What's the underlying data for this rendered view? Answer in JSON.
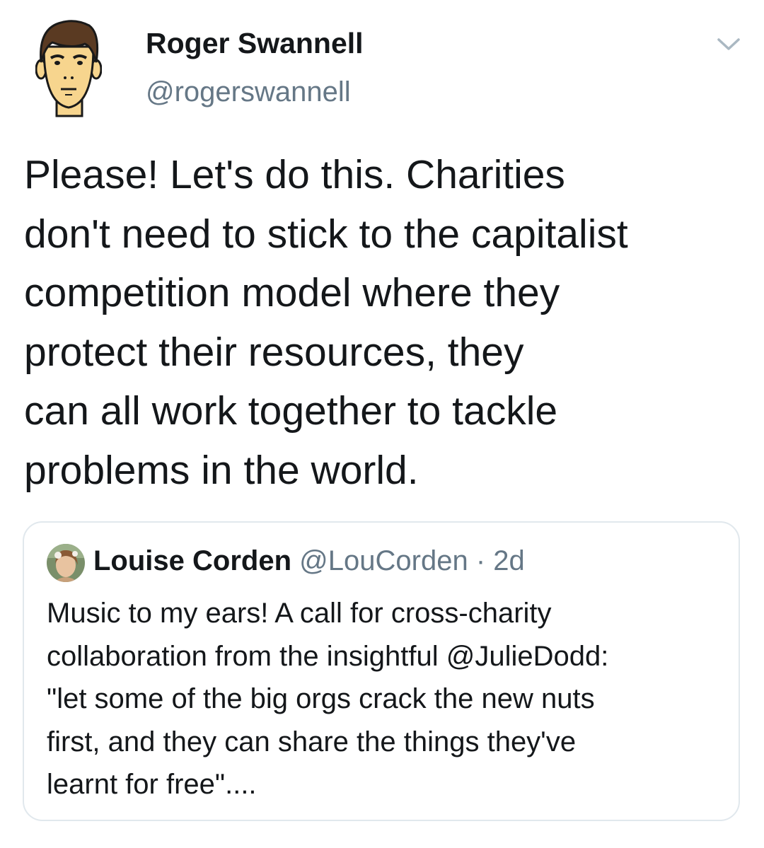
{
  "tweet": {
    "author": {
      "name": "Roger Swannell",
      "handle": "@rogerswannell",
      "avatar_icon": "cartoon-face-avatar"
    },
    "menu_icon": "chevron-down-icon",
    "text_lines": [
      "Please! Let's do this. Charities",
      "don't need to stick to the capitalist",
      "competition model where they",
      "protect their resources, they",
      "can all work together to tackle",
      "problems in the world."
    ]
  },
  "quoted_tweet": {
    "author": {
      "name": "Louise Corden",
      "handle": "@LouCorden",
      "separator": "·",
      "time": "2d",
      "avatar_icon": "photo-avatar"
    },
    "text_lines": [
      "Music to my ears! A call for cross-charity",
      "collaboration from the insightful @JulieDodd:",
      "\"let some of the big orgs crack the new nuts",
      "first, and they can share the things they've",
      "learnt for free\"...."
    ]
  },
  "colors": {
    "text_primary": "#14171a",
    "text_secondary": "#657786",
    "border": "#e1e8ed",
    "skin": "#f7d58e"
  }
}
